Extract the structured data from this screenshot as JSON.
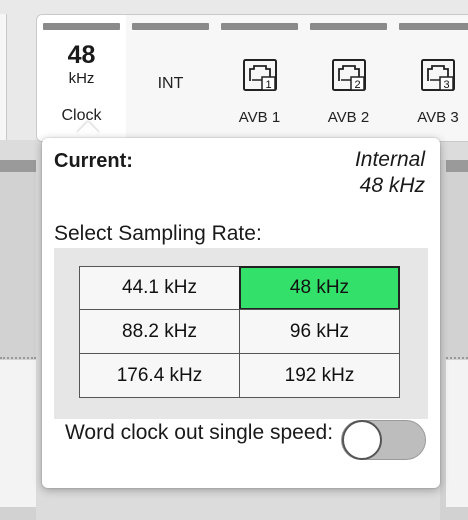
{
  "toolbar": {
    "clock_source": {
      "rate": "48",
      "unit": "kHz",
      "label": "Clock",
      "icon": "clock-source-button"
    },
    "sources": [
      {
        "label": "INT",
        "icon": "internal-clock"
      },
      {
        "label": "AVB 1",
        "icon": "network-port-icon",
        "port_number": "1"
      },
      {
        "label": "AVB 2",
        "icon": "network-port-icon",
        "port_number": "2"
      },
      {
        "label": "AVB 3",
        "icon": "network-port-icon",
        "port_number": "3"
      }
    ]
  },
  "popover": {
    "current_label": "Current:",
    "current_value_line1": "Internal",
    "current_value_line2": "48 kHz",
    "select_title": "Select Sampling Rate:",
    "rates": [
      {
        "label": "44.1 kHz",
        "selected": false
      },
      {
        "label": "48 kHz",
        "selected": true
      },
      {
        "label": "88.2 kHz",
        "selected": false
      },
      {
        "label": "96 kHz",
        "selected": false
      },
      {
        "label": "176.4 kHz",
        "selected": false
      },
      {
        "label": "192 kHz",
        "selected": false
      }
    ],
    "word_clock_label": "Word clock out single speed:",
    "word_clock_single_speed": false
  },
  "colors": {
    "selected_rate": "#33e06a",
    "segment_cap": "#8a8a8a",
    "toggle_off_track": "#bdbdbd",
    "popover_background": "#ffffff",
    "rate_panel_background": "#e6e6e6"
  }
}
